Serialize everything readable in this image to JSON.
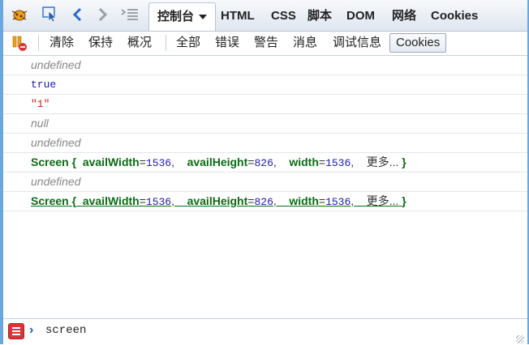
{
  "topbar": {
    "icons": [
      "firebug-bug-icon",
      "inspect-pointer-icon",
      "back-chevron-icon",
      "forward-chevron-icon",
      "collapse-list-icon"
    ],
    "tabs": [
      "控制台",
      "HTML",
      "CSS",
      "脚本",
      "DOM",
      "网络",
      "Cookies"
    ]
  },
  "toolbar": {
    "buttons": [
      "清除",
      "保持",
      "概况",
      "全部",
      "错误",
      "警告",
      "消息",
      "调试信息",
      "Cookies"
    ]
  },
  "log": {
    "row1": "undefined",
    "row2": "true",
    "row3": "\"1\"",
    "row4": "null",
    "row5": "undefined",
    "row6": {
      "name": "Screen",
      "open": "{",
      "k1": "availWidth",
      "v1": "1536",
      "k2": "availHeight",
      "v2": "826",
      "k3": "width",
      "v3": "1536",
      "more": "更多...",
      "close": "}"
    },
    "row7": "undefined",
    "row8": {
      "name": "Screen",
      "open": "{",
      "k1": "availWidth",
      "v1": "1536",
      "k2": "availHeight",
      "v2": "826",
      "k3": "width",
      "v3": "1536",
      "more": "更多...",
      "close": "}"
    }
  },
  "command": {
    "prompt": "›",
    "text": "screen"
  },
  "colors": {
    "accent": "#6aa7de",
    "object": "#0b6b14",
    "number": "#1a1aa6",
    "string": "#cc2020"
  }
}
